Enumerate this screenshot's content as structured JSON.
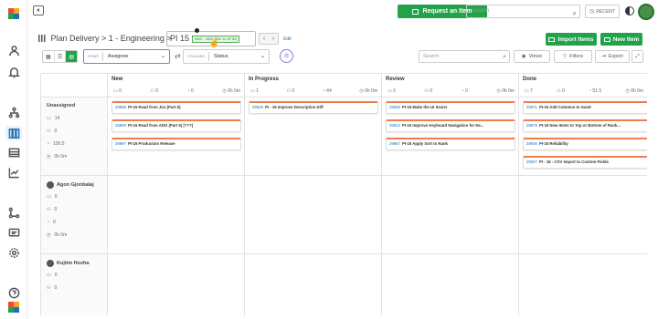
{
  "topbar": {
    "request_label": "Request an Item",
    "search_placeholder": "Search",
    "recent_label": "RECENT"
  },
  "header": {
    "breadcrumb": "Plan Delivery > 1 - Engineering >",
    "pi_label": "PI 15",
    "pi_dates": "06/07 - 09/22 (DAY 10 OF 84)",
    "edit_label": "Edit",
    "import_label": "Import Items",
    "new_label": "New Item"
  },
  "toolbar": {
    "rows_tag": "ROWS",
    "rows_value": "Assignee",
    "cols_tag": "COLUMNS",
    "cols_value": "Status",
    "search_placeholder": "Search",
    "views_label": "Views",
    "filters_label": "Filters",
    "export_label": "Export"
  },
  "columns": [
    {
      "title": "New",
      "stats": [
        "0",
        "0",
        "0",
        "0h 0m"
      ]
    },
    {
      "title": "In Progress",
      "stats": [
        "1",
        "0",
        "44",
        "0h 0m"
      ]
    },
    {
      "title": "Review",
      "stats": [
        "0",
        "0",
        "0",
        "0h 0m"
      ]
    },
    {
      "title": "Done",
      "stats": [
        "7",
        "0",
        "51.5",
        "0h 0m"
      ]
    }
  ],
  "rows": [
    {
      "name": "Unassigned",
      "stats": [
        "14",
        "0",
        "100.5",
        "0h 0m"
      ]
    },
    {
      "name": "Agon Gjonbalaj",
      "stats": [
        "0",
        "0",
        "0",
        "0h 0m"
      ]
    },
    {
      "name": "Kujtim Hoxha",
      "stats": [
        "0",
        "0"
      ]
    }
  ],
  "cards": {
    "new": [
      {
        "id": "29868",
        "text": "PI-15 Read from Jira (Part 5)"
      },
      {
        "id": "29869",
        "text": "PI-15 Read from ADO (Part 5) [???]"
      },
      {
        "id": "29997",
        "text": "PI-15 Production Release"
      }
    ],
    "in_progress": [
      {
        "id": "29929",
        "text": "PI - 15 Improve Description Diff"
      }
    ],
    "review": [
      {
        "id": "29928",
        "text": "PI-15 Make the UI Sexier"
      },
      {
        "id": "29913",
        "text": "PI-15 Improve Keyboard Navigation for Ne..."
      },
      {
        "id": "29967",
        "text": "PI-15 Apply Sort to Rank"
      }
    ],
    "done": [
      {
        "id": "29971",
        "text": "PI-15 Add Columns to Gantt"
      },
      {
        "id": "29978",
        "text": "PI-15 New Items to Top or Bottom of Rank..."
      },
      {
        "id": "29936",
        "text": "PI-15 Reliability"
      },
      {
        "id": "29937",
        "text": "PI - 15 - CSV Import to Custom Fields"
      }
    ]
  }
}
